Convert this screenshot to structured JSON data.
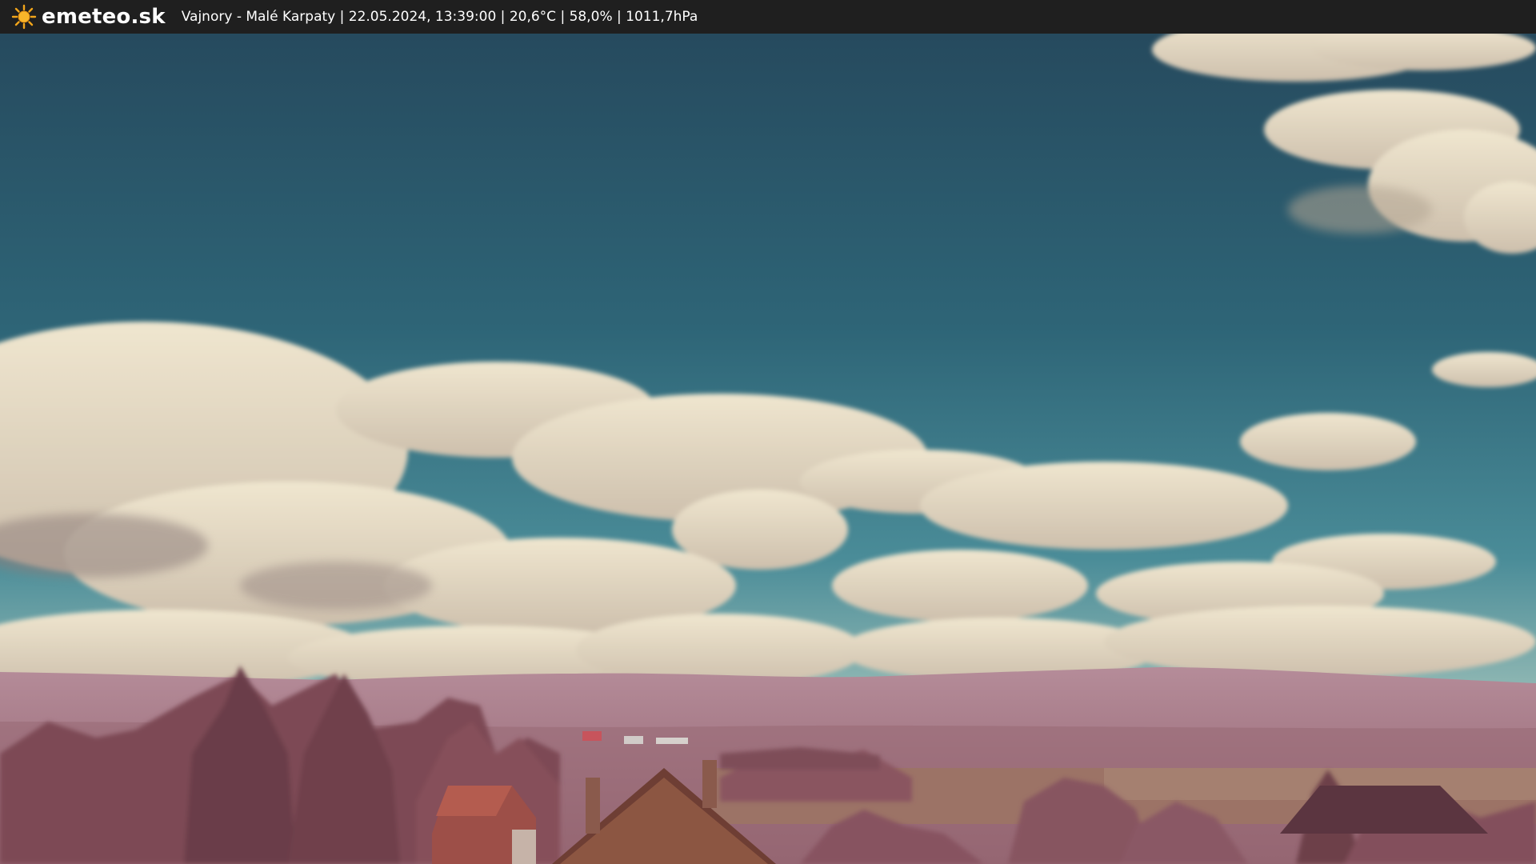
{
  "header": {
    "brand": "emeteo.sk",
    "location": "Vajnory - Malé Karpaty",
    "datetime": "22.05.2024, 13:39:00",
    "temperature": "20,6°C",
    "humidity": "58,0%",
    "pressure": "1011,7hPa",
    "separator": " | "
  },
  "icons": {
    "logo": "sun-icon"
  },
  "colors": {
    "bar": "#1f1f1f",
    "sun": "#f2a51a",
    "sky_top": "#294f63",
    "sky_mid": "#2f6678",
    "cloud": "#e7dcc3",
    "cloud_shade": "#b6a79a",
    "hills": "#a87c8a",
    "foliage": "#8b5560",
    "field": "#9a6f5e"
  }
}
